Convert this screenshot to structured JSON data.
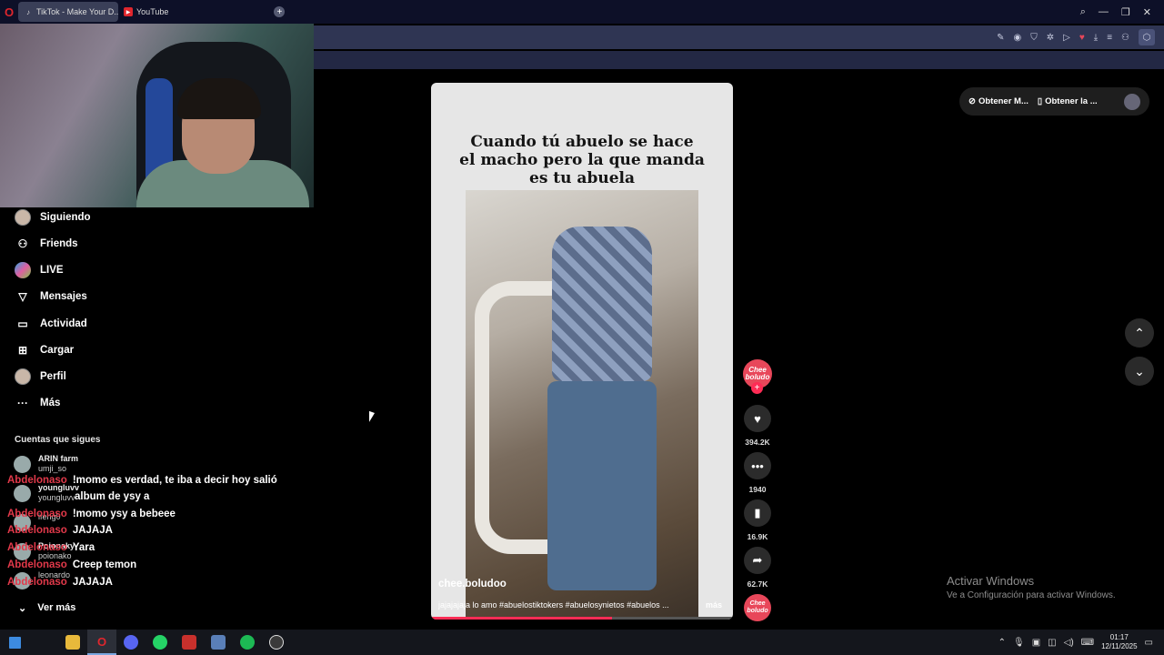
{
  "browser": {
    "tabs": [
      {
        "label": "TikTok - Make Your D..."
      },
      {
        "label": "YouTube"
      }
    ],
    "new_tab": "+"
  },
  "sidebar": {
    "items": [
      {
        "label": "Siguiendo",
        "icon": "following-avatar-icon"
      },
      {
        "label": "Friends",
        "icon": "friends-icon"
      },
      {
        "label": "LIVE",
        "icon": "live-icon"
      },
      {
        "label": "Mensajes",
        "icon": "messages-icon"
      },
      {
        "label": "Actividad",
        "icon": "activity-icon"
      },
      {
        "label": "Cargar",
        "icon": "upload-icon"
      },
      {
        "label": "Perfil",
        "icon": "profile-avatar-icon"
      },
      {
        "label": "Más",
        "icon": "more-icon"
      }
    ],
    "following_title": "Cuentas que sigues",
    "following": [
      {
        "name": "ARIN farm",
        "handle": "umji_so"
      },
      {
        "name": "youngluvv",
        "handle": "youngluvv"
      },
      {
        "name": "",
        "handle": "ifeng0"
      },
      {
        "name": "Poionaky",
        "handle": "poionako"
      },
      {
        "name": "",
        "handle": "leonardo"
      }
    ],
    "see_more": "Ver más"
  },
  "chat": [
    {
      "user": "Abdelonaso",
      "msg": "!momo es verdad, te iba a decir hoy salió"
    },
    {
      "user": "",
      "msg": "album de ysy a"
    },
    {
      "user": "Abdelonaso",
      "msg": "!momo ysy a bebeee"
    },
    {
      "user": "Abdelonaso",
      "msg": "JAJAJA"
    },
    {
      "user": "Abdelonaso",
      "msg": "Yara"
    },
    {
      "user": "Abdelonaso",
      "msg": "Creep temon"
    },
    {
      "user": "Abdelonaso",
      "msg": "JAJAJA"
    }
  ],
  "video": {
    "caption_lines": [
      "Cuando tú abuelo se hace",
      "el macho pero la que manda",
      "es tu abuela"
    ],
    "author": "chee.boludoo",
    "description": "jajajajaja lo amo #abuelostiktokers #abuelosynietos #abuelos ...",
    "more": "más",
    "progress": 0.6
  },
  "rail": {
    "avatar_text": "Chee boludo",
    "likes": "394.2K",
    "comments": "1940",
    "saves": "16.9K",
    "shares": "62.7K",
    "sound_text": "Chee boludo"
  },
  "top_right": {
    "get_app1": "Obtener M...",
    "get_app2": "Obtener la ..."
  },
  "windows_notice": {
    "title": "Activar Windows",
    "subtitle": "Ve a Configuración para activar Windows."
  },
  "clock": {
    "time": "01:17",
    "date": "12/11/2025"
  },
  "colors": {
    "accent": "#fe2c55",
    "chat_user": "#e2394a",
    "chrome": "#0d1028"
  }
}
